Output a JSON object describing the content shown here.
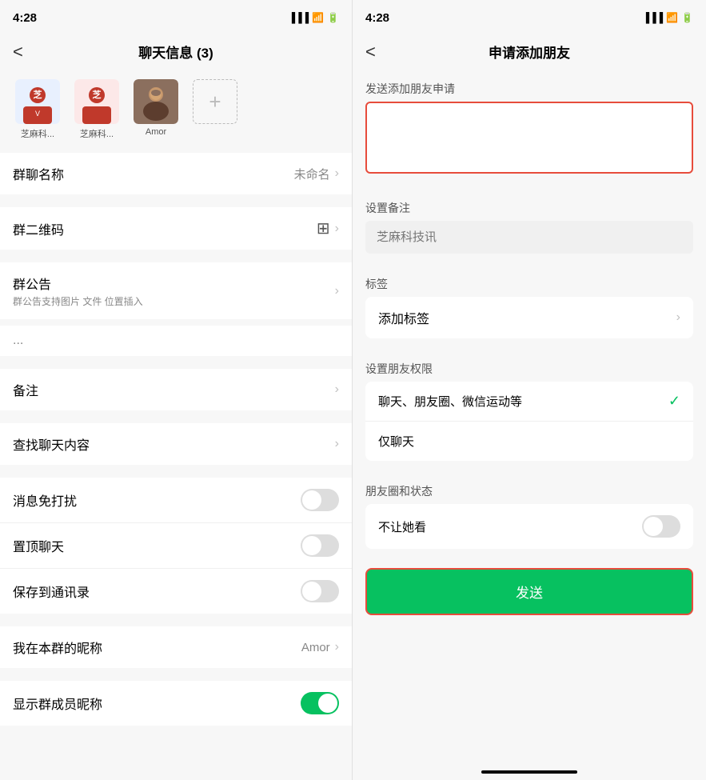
{
  "left": {
    "status_time": "4:28",
    "header_title": "聊天信息 (3)",
    "back_label": "<",
    "members": [
      {
        "name": "芝麻科...",
        "type": "zhima1"
      },
      {
        "name": "芝麻科...",
        "type": "zhima2"
      },
      {
        "name": "Amor",
        "type": "amor"
      }
    ],
    "add_label": "+",
    "settings": [
      {
        "section": "group_name",
        "items": [
          {
            "label": "群聊名称",
            "right_text": "未命名",
            "has_chevron": true,
            "has_toggle": false
          }
        ]
      },
      {
        "section": "group_qr",
        "items": [
          {
            "label": "群二维码",
            "right_text": "",
            "has_qr": true,
            "has_chevron": true,
            "has_toggle": false
          }
        ]
      },
      {
        "section": "group_notice",
        "items": [
          {
            "label": "群公告",
            "sublabel": "群公告支持图片 文件 位置插入",
            "right_text": "",
            "has_chevron": true,
            "has_toggle": false
          }
        ]
      },
      {
        "section": "ellipsis",
        "text": "..."
      },
      {
        "section": "remark",
        "items": [
          {
            "label": "备注",
            "right_text": "",
            "has_chevron": true,
            "has_toggle": false
          }
        ]
      },
      {
        "section": "search",
        "items": [
          {
            "label": "查找聊天内容",
            "right_text": "",
            "has_chevron": true,
            "has_toggle": false
          }
        ]
      },
      {
        "section": "toggles",
        "items": [
          {
            "label": "消息免打扰",
            "has_toggle": true,
            "toggle_on": false
          },
          {
            "label": "置顶聊天",
            "has_toggle": true,
            "toggle_on": false
          },
          {
            "label": "保存到通讯录",
            "has_toggle": true,
            "toggle_on": false
          }
        ]
      },
      {
        "section": "nickname",
        "items": [
          {
            "label": "我在本群的昵称",
            "right_text": "Amor",
            "has_chevron": true,
            "has_toggle": false
          }
        ]
      },
      {
        "section": "show_members",
        "items": [
          {
            "label": "显示群成员昵称",
            "has_toggle": true,
            "toggle_on": true
          }
        ]
      }
    ]
  },
  "right": {
    "status_time": "4:28",
    "header_title": "申请添加朋友",
    "back_label": "<",
    "send_request_label": "发送添加朋友申请",
    "send_request_placeholder": "",
    "remark_label": "设置备注",
    "remark_placeholder": "芝麻科技讯",
    "tag_label": "标签",
    "tag_add_label": "添加标签",
    "permission_label": "设置朋友权限",
    "permission_options": [
      {
        "label": "聊天、朋友圈、微信运动等",
        "selected": true
      },
      {
        "label": "仅聊天",
        "selected": false
      }
    ],
    "moments_label": "朋友圈和状态",
    "moments_option": "不让她看",
    "send_button_label": "发送"
  }
}
